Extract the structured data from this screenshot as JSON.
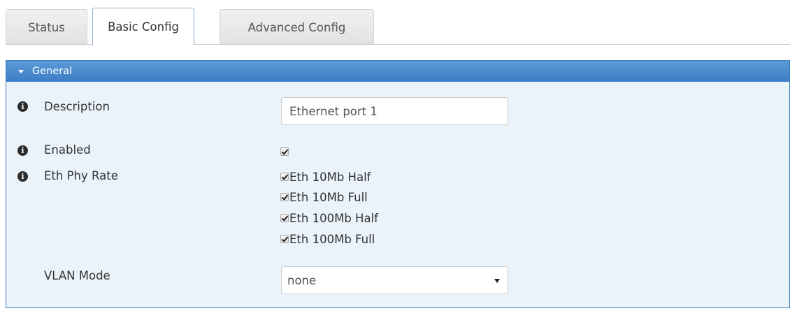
{
  "tabs": [
    {
      "label": "Status",
      "active": false
    },
    {
      "label": "Basic Config",
      "active": true
    },
    {
      "label": "Advanced Config",
      "active": false
    }
  ],
  "panel": {
    "title": "General"
  },
  "fields": {
    "description": {
      "label": "Description",
      "value": "Ethernet port 1"
    },
    "enabled": {
      "label": "Enabled",
      "checked": true
    },
    "eth_phy_rate": {
      "label": "Eth Phy Rate",
      "options": [
        {
          "label": "Eth 10Mb Half",
          "checked": true
        },
        {
          "label": "Eth 10Mb Full",
          "checked": true
        },
        {
          "label": "Eth 100Mb Half",
          "checked": true
        },
        {
          "label": "Eth 100Mb Full",
          "checked": true
        }
      ]
    },
    "vlan_mode": {
      "label": "VLAN Mode",
      "value": "none"
    }
  },
  "icons": {
    "info": "info-circle-icon",
    "checkbox": "checkbox-checked-icon",
    "caret": "caret-down-icon"
  },
  "colors": {
    "panel_header": "#4a8ccf",
    "panel_body": "#eaf2fa",
    "active_tab_border": "#8fb0cf"
  }
}
